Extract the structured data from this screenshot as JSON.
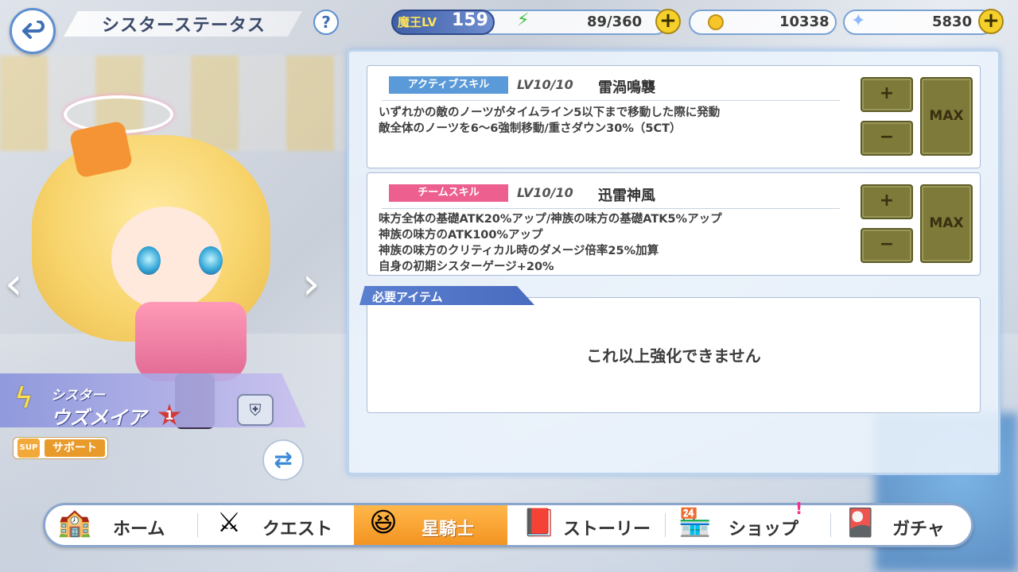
{
  "header": {
    "title": "シスターステータス",
    "help_label": "?",
    "level_label": "魔王LV",
    "level_value": "159",
    "stamina": "89/360",
    "coins": "10338",
    "gems": "5830"
  },
  "character": {
    "class_label": "シスター",
    "name": "ウズメイア",
    "rank": "1",
    "support_badge": "SUP",
    "support_label": "サポート"
  },
  "skills": [
    {
      "tag": "アクティブスキル",
      "level": "LV10/10",
      "name": "雷渦鳴襲",
      "description": [
        "いずれかの敵のノーツがタイムライン5以下まで移動した際に発動",
        "敵全体のノーツを6～6強制移動/重さダウン30%（5CT）"
      ],
      "plus_label": "+",
      "minus_label": "−",
      "max_label": "MAX"
    },
    {
      "tag": "チームスキル",
      "level": "LV10/10",
      "name": "迅雷神風",
      "description": [
        "味方全体の基礎ATK20%アップ/神族の味方の基礎ATK5%アップ",
        "神族の味方のATK100%アップ",
        "神族の味方のクリティカル時のダメージ倍率25%加算",
        "自身の初期シスターゲージ+20%"
      ],
      "plus_label": "+",
      "minus_label": "−",
      "max_label": "MAX"
    }
  ],
  "required_items": {
    "title": "必要アイテム",
    "message": "これ以上強化できません"
  },
  "nav": [
    {
      "label": "ホーム",
      "icon": "home-icon"
    },
    {
      "label": "クエスト",
      "icon": "sword-icon"
    },
    {
      "label": "星騎士",
      "icon": "knight-icon",
      "active": true
    },
    {
      "label": "ストーリー",
      "icon": "book-icon"
    },
    {
      "label": "ショップ",
      "icon": "shop-icon",
      "notification": "!"
    },
    {
      "label": "ガチャ",
      "icon": "gacha-icon"
    }
  ],
  "colors": {
    "accent_blue": "#5a9ad8",
    "team_pink": "#ec5f8e",
    "max_olive": "#7d7a3a",
    "nav_active": "#f39422"
  }
}
